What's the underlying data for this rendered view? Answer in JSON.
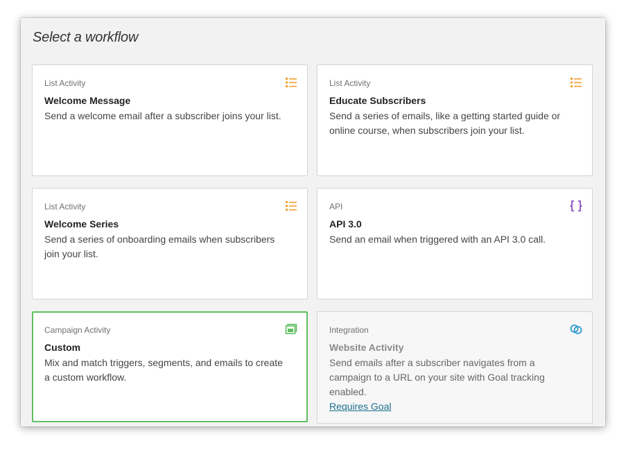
{
  "title": "Select a workflow",
  "colors": {
    "list_icon": "#f0a030",
    "api_icon": "#8a4fc0",
    "campaign_icon": "#5fbf5f",
    "integration_icon": "#2d9ad0",
    "selected_border": "#5fbf5f",
    "link": "#1c6f8c"
  },
  "cards": [
    {
      "category": "List Activity",
      "name": "Welcome Message",
      "description": "Send a welcome email after a subscriber joins your list.",
      "icon": "list-icon"
    },
    {
      "category": "List Activity",
      "name": "Educate Subscribers",
      "description": "Send a series of emails, like a getting started guide or online course, when subscribers join your list.",
      "icon": "list-icon"
    },
    {
      "category": "List Activity",
      "name": "Welcome Series",
      "description": "Send a series of onboarding emails when subscribers join your list.",
      "icon": "list-icon"
    },
    {
      "category": "API",
      "name": "API 3.0",
      "description": "Send an email when triggered with an API 3.0 call.",
      "icon": "braces-icon"
    },
    {
      "category": "Campaign Activity",
      "name": "Custom",
      "description": "Mix and match triggers, segments, and emails to create a custom workflow.",
      "icon": "campaign-icon",
      "selected": true
    },
    {
      "category": "Integration",
      "name": "Website Activity",
      "description": "Send emails after a subscriber navigates from a campaign to a URL on your site with Goal tracking enabled.",
      "icon": "link-rings-icon",
      "disabled": true,
      "link_label": "Requires Goal"
    }
  ]
}
